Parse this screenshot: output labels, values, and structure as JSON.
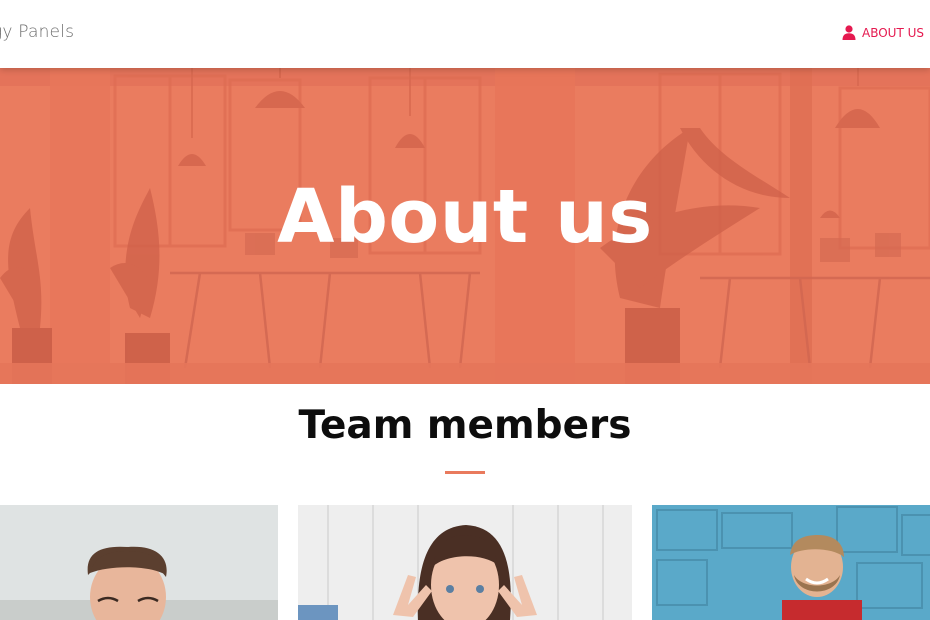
{
  "navbar": {
    "brand": "gy Panels",
    "about_link": {
      "label": "ABOUT US",
      "icon": "user-icon",
      "color": "#e5194f"
    }
  },
  "hero": {
    "title": "About us",
    "overlay_color": "#e97a5d"
  },
  "team": {
    "title": "Team members",
    "accent_color": "#e97a5d",
    "members": [
      {
        "photo": "team-member-photo"
      },
      {
        "photo": "team-member-photo"
      },
      {
        "photo": "team-member-photo"
      }
    ]
  }
}
